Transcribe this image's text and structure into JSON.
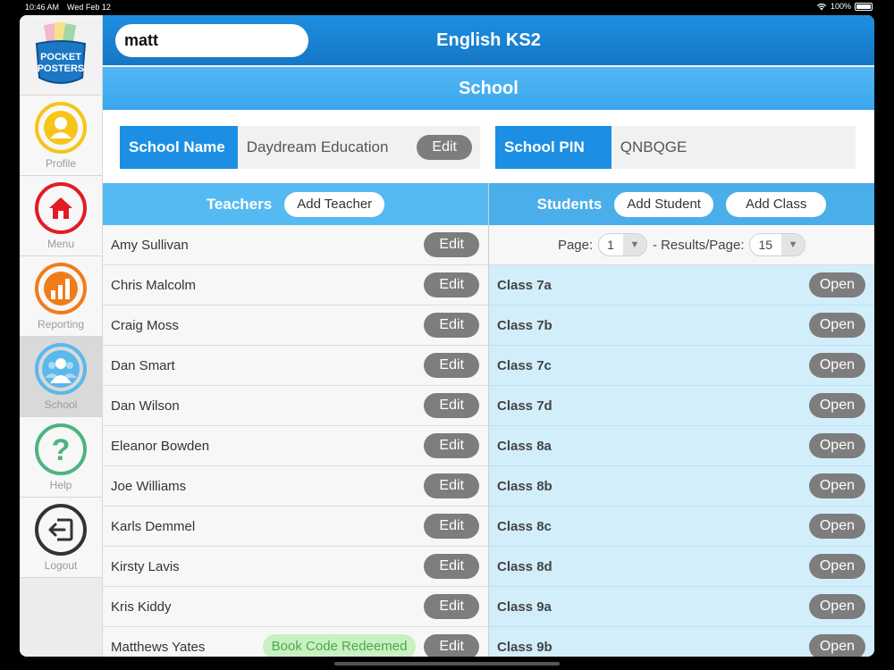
{
  "status": {
    "time": "10:46 AM",
    "date": "Wed Feb 12",
    "battery": "100%"
  },
  "logo": {
    "line1": "POCKET",
    "line2": "POSTERS"
  },
  "sidebar": {
    "items": [
      {
        "label": "Profile",
        "icon": "person-icon",
        "color": "#f5c518"
      },
      {
        "label": "Menu",
        "icon": "home-icon",
        "color": "#e31b23"
      },
      {
        "label": "Reporting",
        "icon": "bar-chart-icon",
        "color": "#f07c1a"
      },
      {
        "label": "School",
        "icon": "group-icon",
        "color": "#5bb8ea"
      },
      {
        "label": "Help",
        "icon": "question-icon",
        "color": "#4db380"
      },
      {
        "label": "Logout",
        "icon": "logout-icon",
        "color": "#333333"
      }
    ]
  },
  "header": {
    "user_value": "matt",
    "title": "English KS2"
  },
  "section": {
    "title": "School"
  },
  "school": {
    "name_label": "School Name",
    "name_value": "Daydream Education",
    "edit_label": "Edit",
    "pin_label": "School PIN",
    "pin_value": "QNBQGE"
  },
  "teachers": {
    "heading": "Teachers",
    "add_label": "Add Teacher",
    "edit_label": "Edit",
    "rows": [
      {
        "name": "Amy Sullivan"
      },
      {
        "name": "Chris Malcolm"
      },
      {
        "name": "Craig Moss"
      },
      {
        "name": "Dan Smart"
      },
      {
        "name": "Dan Wilson"
      },
      {
        "name": "Eleanor Bowden"
      },
      {
        "name": "Joe Williams"
      },
      {
        "name": "Karls Demmel"
      },
      {
        "name": "Kirsty Lavis"
      },
      {
        "name": "Kris Kiddy"
      },
      {
        "name": "Matthews Yates",
        "badge": "Book Code Redeemed"
      }
    ]
  },
  "students": {
    "heading": "Students",
    "add_student_label": "Add Student",
    "add_class_label": "Add Class",
    "open_label": "Open",
    "pager": {
      "page_label": "Page:",
      "page_value": "1",
      "results_label": "- Results/Page:",
      "results_value": "15"
    },
    "classes": [
      "Class 7a",
      "Class 7b",
      "Class 7c",
      "Class 7d",
      "Class 8a",
      "Class 8b",
      "Class 8c",
      "Class 8d",
      "Class 9a",
      "Class 9b"
    ]
  }
}
